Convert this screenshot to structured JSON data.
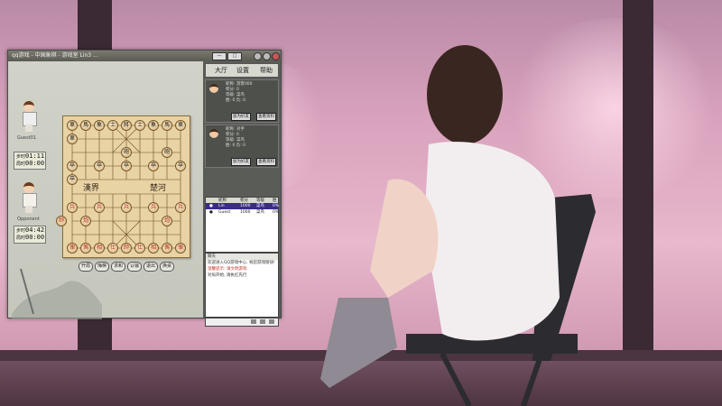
{
  "window": {
    "title": "qq游戏 - 中国象棋 - 游戏室 Lin3  ...",
    "btn_min": "—",
    "btn_max": "□",
    "btn_close": "×"
  },
  "top_player": {
    "name": "Guest01",
    "step_label": "步时",
    "step_value": "01:11",
    "total_label": "局时",
    "total_value": "00:00"
  },
  "bottom_player": {
    "name": "Opponent",
    "step_label": "步时",
    "step_value": "04:42",
    "total_label": "局时",
    "total_value": "00:00"
  },
  "board": {
    "river_left": "漢界",
    "river_right": "楚河"
  },
  "controls": [
    "开局",
    "悔棋",
    "求和",
    "认输",
    "退出",
    "换桌"
  ],
  "panel": {
    "tabs": [
      "大厅",
      "设置",
      "帮助"
    ],
    "seat1": {
      "name": "昵称: 游客000",
      "lines": [
        "积分: 0",
        "等级: 菜鸟",
        "胜: 0 负: 0"
      ],
      "btn1": "加为好友",
      "btn2": "查看资料"
    },
    "seat2": {
      "name": "昵称: 对手",
      "lines": [
        "积分: 0",
        "等级: 菜鸟",
        "胜: 0 负: 0"
      ],
      "btn1": "加为好友",
      "btn2": "查看资料"
    },
    "list_headers": [
      "昵称",
      "积分",
      "等级",
      "胜率"
    ],
    "list_rows": [
      {
        "name": "Lin",
        "score": "1000",
        "level": "菜鸟",
        "rate": "0%"
      },
      {
        "name": "Guest",
        "score": "1000",
        "level": "菜鸟",
        "rate": "0%"
      }
    ],
    "chat_header": "聊天",
    "chat_lines": [
      {
        "text": "欢迎进入QQ游戏中心, 祝您游戏愉快!",
        "red": false
      },
      {
        "text": "温馨提示: 请文明游戏",
        "red": true
      },
      {
        "text": "对局开始, 请执红先行",
        "red": false
      }
    ]
  }
}
